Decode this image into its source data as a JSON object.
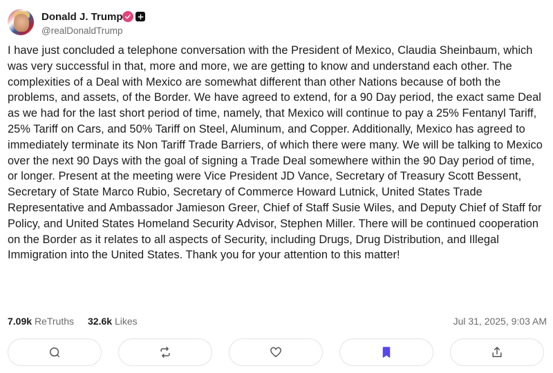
{
  "author": {
    "display_name": "Donald J. Trump",
    "handle": "@realDonaldTrump",
    "verified_badge_color": "#e0457b"
  },
  "post": {
    "text": "I have just concluded a telephone conversation with the President of Mexico, Claudia Sheinbaum, which was very successful in that, more and more, we are getting to know and understand each other. The complexities of a Deal with Mexico are somewhat different than other Nations because of both the problems, and assets, of the Border. We have agreed to extend, for a 90 Day period, the exact same Deal as we had for the last short period of time, namely, that Mexico will continue to pay a 25% Fentanyl Tariff, 25% Tariff on Cars, and 50% Tariff on Steel, Aluminum, and Copper. Additionally, Mexico has agreed to immediately terminate its Non Tariff Trade Barriers, of which there were many. We will be talking to Mexico over the next 90 Days with the goal of signing a Trade Deal somewhere within the 90 Day period of time, or longer. Present at the meeting were Vice President JD Vance, Secretary of Treasury Scott Bessent, Secretary of State Marco Rubio, Secretary of Commerce Howard Lutnick, United States Trade Representative and Ambassador Jamieson Greer, Chief of Staff Susie Wiles, and Deputy Chief of Staff for Policy, and United States Homeland Security Advisor, Stephen Miller. There will be continued cooperation on the Border as it relates to all aspects of Security, including Drugs, Drug Distribution, and Illegal Immigration into the United States. Thank you for your attention to this matter!"
  },
  "stats": {
    "retruths_count": "7.09k",
    "retruths_label": "ReTruths",
    "likes_count": "32.6k",
    "likes_label": "Likes",
    "timestamp": "Jul 31, 2025, 9:03 AM"
  },
  "actions": [
    {
      "icon": "comment-icon"
    },
    {
      "icon": "retruth-icon"
    },
    {
      "icon": "heart-icon"
    },
    {
      "icon": "bookmark-icon",
      "active_color": "#5448ee"
    },
    {
      "icon": "share-icon"
    }
  ]
}
